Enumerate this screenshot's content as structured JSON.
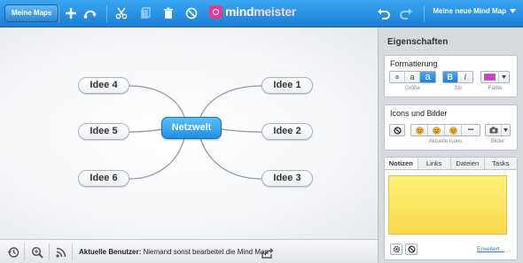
{
  "header": {
    "maps_button": "Meine Maps",
    "logo_prefix": "mind",
    "logo_suffix": "meister",
    "map_menu": "Meine neue Mind Map",
    "accent": "#1b7fd6",
    "logo_color": "#e23b8f"
  },
  "map": {
    "central": "Netzwelt",
    "ideas": [
      "Idee 1",
      "Idee 2",
      "Idee 3",
      "Idee 4",
      "Idee 5",
      "Idee 6"
    ]
  },
  "footer": {
    "users_label": "Aktuelle Benutzer:",
    "users_text": "Niemand sonst bearbeitet die Mind Map"
  },
  "panel": {
    "title": "Eigenschaften",
    "formatting": {
      "title": "Formatierung",
      "size_options": [
        "a",
        "a",
        "a"
      ],
      "style_options": [
        "B",
        "I"
      ],
      "size_caption": "Größe",
      "style_caption": "Stil",
      "color_caption": "Farbe",
      "color": "#d63ac8"
    },
    "icons": {
      "title": "Icons und Bilder",
      "current_caption": "Aktuelle Icons",
      "images_caption": "Bilder",
      "more": "•••"
    },
    "notes": {
      "tabs": [
        "Notizen",
        "Links",
        "Dateien",
        "Tasks"
      ],
      "active_tab": "Notizen",
      "note_color": "#fde86a",
      "extended_link": "Erweitert..."
    }
  }
}
